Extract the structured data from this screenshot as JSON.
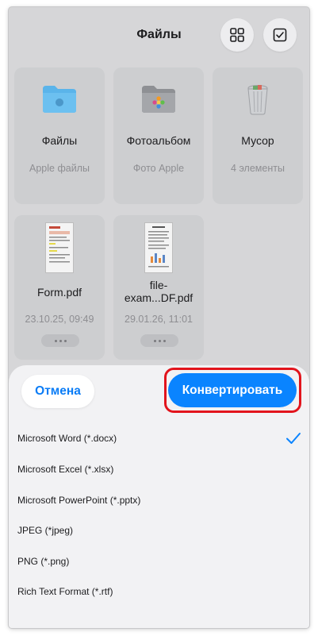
{
  "header": {
    "title": "Файлы"
  },
  "toolbar": {
    "grid_icon": "grid-icon",
    "select_icon": "checkbox-icon"
  },
  "folders": [
    {
      "name": "Файлы",
      "subtitle": "Apple файлы",
      "icon": "folder-icon",
      "color": "#5ab4ea"
    },
    {
      "name": "Фотоальбом",
      "subtitle": "Фото Apple",
      "icon": "photos-folder-icon",
      "color": "#9a9ca0"
    },
    {
      "name": "Мусор",
      "subtitle": "4 элементы",
      "icon": "trash-icon",
      "color": "#b8babd"
    }
  ],
  "files": [
    {
      "name": "Form.pdf",
      "date": "23.10.25, 09:49"
    },
    {
      "name_line1": "file-",
      "name_line2": "exam...DF.pdf",
      "date": "29.01.26, 11:01"
    }
  ],
  "sheet": {
    "cancel_label": "Отмена",
    "convert_label": "Конвертировать",
    "highlight_color": "#e2141c",
    "accent_color": "#0a84ff",
    "options": [
      {
        "label": "Microsoft Word (*.docx)",
        "selected": true
      },
      {
        "label": "Microsoft Excel (*.xlsx)",
        "selected": false
      },
      {
        "label": "Microsoft PowerPoint (*.pptx)",
        "selected": false
      },
      {
        "label": "JPEG (*jpeg)",
        "selected": false
      },
      {
        "label": "PNG (*.png)",
        "selected": false
      },
      {
        "label": "Rich Text Format (*.rtf)",
        "selected": false
      }
    ]
  }
}
